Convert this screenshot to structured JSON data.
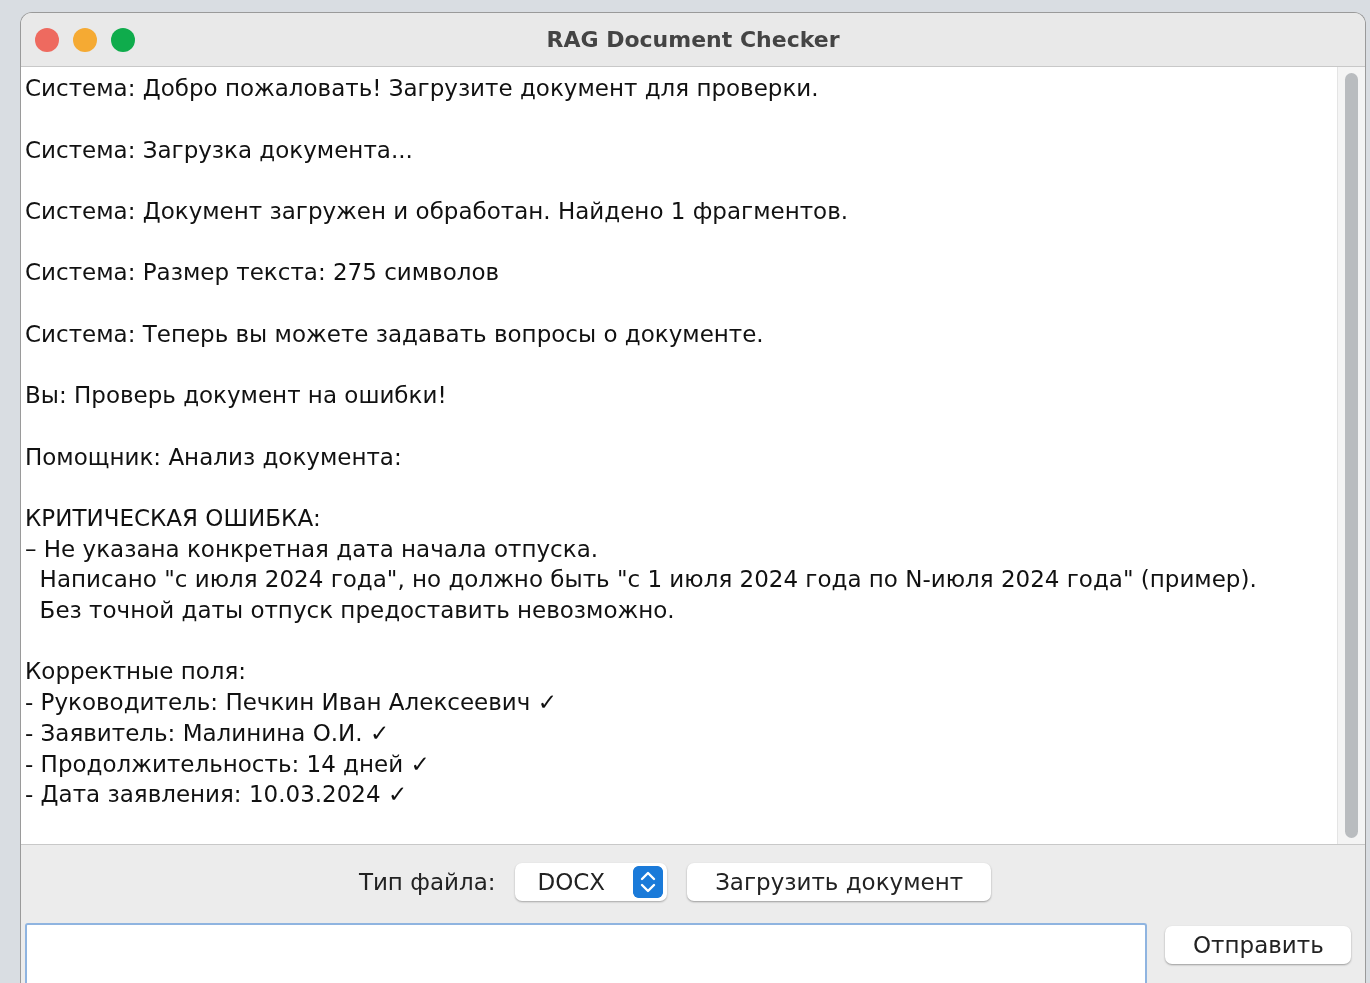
{
  "window": {
    "title": "RAG Document Checker"
  },
  "log": [
    {
      "lines": [
        "Система: Добро пожаловать! Загрузите документ для проверки."
      ]
    },
    {
      "lines": [
        "Система: Загрузка документа..."
      ]
    },
    {
      "lines": [
        "Система: Документ загружен и обработан. Найдено 1 фрагментов."
      ]
    },
    {
      "lines": [
        "Система: Размер текста: 275 символов"
      ]
    },
    {
      "lines": [
        "Система: Теперь вы можете задавать вопросы о документе."
      ]
    },
    {
      "lines": [
        "Вы: Проверь документ на ошибки!"
      ]
    },
    {
      "lines": [
        "Помощник: Анализ документа:"
      ]
    },
    {
      "lines": [
        "КРИТИЧЕСКАЯ ОШИБКА:",
        "– Не указана конкретная дата начала отпуска.",
        "  Написано \"с июля 2024 года\", но должно быть \"с 1 июля 2024 года по N-июля 2024 года\" (пример).",
        "  Без точной даты отпуск предоставить невозможно."
      ]
    },
    {
      "lines": [
        "Корректные поля:",
        "- Руководитель: Печкин Иван Алексеевич ✓",
        "- Заявитель: Малинина О.И. ✓",
        "- Продолжительность: 14 дней ✓",
        "- Дата заявления: 10.03.2024 ✓"
      ]
    }
  ],
  "controls": {
    "file_type_label": "Тип файла:",
    "file_type": {
      "value": "DOCX"
    },
    "upload_button": "Загрузить документ"
  },
  "send_button": "Отправить"
}
